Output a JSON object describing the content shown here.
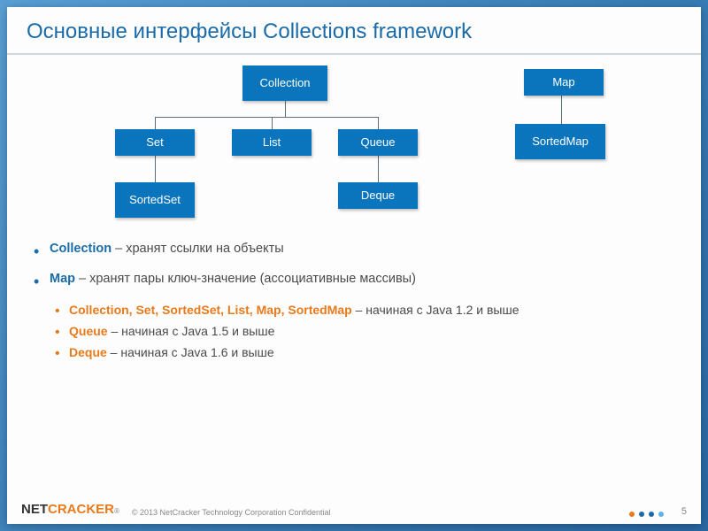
{
  "title": "Основные интерфейсы Collections framework",
  "nodes": {
    "collection": "Collection",
    "set": "Set",
    "list": "List",
    "queue": "Queue",
    "sortedset": "SortedSet",
    "deque": "Deque",
    "map": "Map",
    "sortedmap": "SortedMap"
  },
  "bullets": {
    "b1_kw": "Collection",
    "b1_text": " – хранят ссылки на объекты",
    "b2_kw": "Map",
    "b2_text": " – хранят пары ключ-значение (ассоциативные массивы)",
    "s1_kw": "Collection, Set, SortedSet, List, Map, SortedMap",
    "s1_text": " – начиная с Java 1.2 и выше",
    "s2_kw": "Queue",
    "s2_text": " – начиная с Java 1.5 и выше",
    "s3_kw": "Deque",
    "s3_text": " – начиная с Java 1.6 и выше"
  },
  "footer": {
    "logo_a": "NET",
    "logo_b": "CRACKER",
    "reg": "®",
    "copyright": "© 2013 NetCracker Technology Corporation Confidential",
    "page": "5"
  },
  "colors": {
    "d1": "#e87a1c",
    "d2": "#1a6ba8",
    "d3": "#1a6ba8",
    "d4": "#5ab4e6"
  }
}
